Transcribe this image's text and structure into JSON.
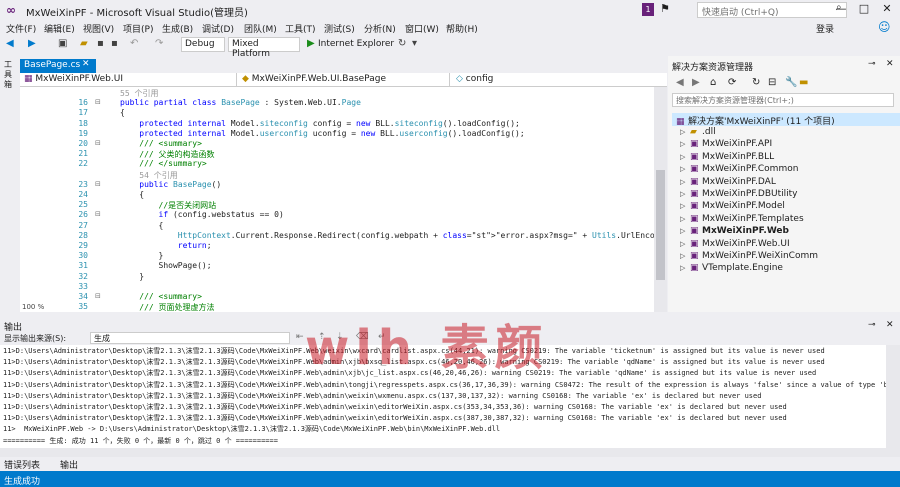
{
  "title": "MxWeiXinPF - Microsoft Visual Studio(管理员)",
  "badge": "1",
  "quick_launch": "快速启动 (Ctrl+Q)",
  "menu": [
    "文件(F)",
    "编辑(E)",
    "视图(V)",
    "项目(P)",
    "生成(B)",
    "调试(D)",
    "团队(M)",
    "工具(T)",
    "测试(S)",
    "分析(N)",
    "窗口(W)",
    "帮助(H)"
  ],
  "login": "登录",
  "toolbar": {
    "config": "Debug",
    "platform": "Mixed Platform",
    "run": "Internet Explorer"
  },
  "left_strip": "工具箱",
  "doc_tab": "BasePage.cs",
  "nav": {
    "project": "MxWeiXinPF.Web.UI",
    "class": "MxWeiXinPF.Web.UI.BasePage",
    "member": "config"
  },
  "code": [
    {
      "ln": "",
      "text": "55 个引用",
      "ref": true
    },
    {
      "ln": "16",
      "text": "public partial class BasePage : System.Web.UI.Page"
    },
    {
      "ln": "17",
      "text": "{"
    },
    {
      "ln": "18",
      "text": "    protected internal Model.siteconfig config = new BLL.siteconfig().loadConfig();"
    },
    {
      "ln": "19",
      "text": "    protected internal Model.userconfig uconfig = new BLL.userconfig().loadConfig();"
    },
    {
      "ln": "20",
      "text": "    /// <summary>"
    },
    {
      "ln": "21",
      "text": "    /// 父类的构造函数"
    },
    {
      "ln": "22",
      "text": "    /// </summary>"
    },
    {
      "ln": "",
      "text": "    54 个引用",
      "ref": true
    },
    {
      "ln": "23",
      "text": "    public BasePage()"
    },
    {
      "ln": "24",
      "text": "    {"
    },
    {
      "ln": "25",
      "text": "        //是否关闭网站"
    },
    {
      "ln": "26",
      "text": "        if (config.webstatus == 0)"
    },
    {
      "ln": "27",
      "text": "        {"
    },
    {
      "ln": "28",
      "text": "            HttpContext.Current.Response.Redirect(config.webpath + \"error.aspx?msg=\" + Utils.UrlEncode(config.webcloser"
    },
    {
      "ln": "29",
      "text": "            return;"
    },
    {
      "ln": "30",
      "text": "        }"
    },
    {
      "ln": "31",
      "text": "        ShowPage();"
    },
    {
      "ln": "32",
      "text": "    }"
    },
    {
      "ln": "33",
      "text": ""
    },
    {
      "ln": "34",
      "text": "    /// <summary>"
    },
    {
      "ln": "35",
      "text": "    /// 页面处理虚方法"
    }
  ],
  "zoom": "100 %",
  "solution_explorer": {
    "title": "解决方案资源管理器",
    "search": "搜索解决方案资源管理器(Ctrl+;)",
    "solution": "解决方案'MxWeiXinPF' (11 个项目)",
    "items": [
      ".dll",
      "MxWeiXinPF.API",
      "MxWeiXinPF.BLL",
      "MxWeiXinPF.Common",
      "MxWeiXinPF.DAL",
      "MxWeiXinPF.DBUtility",
      "MxWeiXinPF.Model",
      "MxWeiXinPF.Templates",
      "MxWeiXinPF.Web",
      "MxWeiXinPF.Web.UI",
      "MxWeiXinPF.WeiXinComm",
      "VTemplate.Engine"
    ]
  },
  "output": {
    "title": "输出",
    "source_label": "显示输出来源(S):",
    "source_value": "生成",
    "lines": [
      "11>D:\\Users\\Administrator\\Desktop\\沫雪2.1.3\\沫雪2.1.3源码\\Code\\MxWeiXinPF.Web\\weixin\\wxcard\\cardlist.aspx.cs(44,21): warning CS0219: The variable 'ticketnum' is assigned but its value is never used",
      "11>D:\\Users\\Administrator\\Desktop\\沫雪2.1.3\\沫雪2.1.3源码\\Code\\MxWeiXinPF.Web\\admin\\xjb\\bxsq_list.aspx.cs(46,20,46,26): warning CS0219: The variable 'qdName' is assigned but its value is never used",
      "11>D:\\Users\\Administrator\\Desktop\\沫雪2.1.3\\沫雪2.1.3源码\\Code\\MxWeiXinPF.Web\\admin\\xjb\\jc_list.aspx.cs(46,20,46,26): warning CS0219: The variable 'qdName' is assigned but its value is never used",
      "11>D:\\Users\\Administrator\\Desktop\\沫雪2.1.3\\沫雪2.1.3源码\\Code\\MxWeiXinPF.Web\\admin\\tongji\\regresspets.aspx.cs(36,17,36,39): warning CS0472: The result of the expression is always 'false' since a value of type 'bool'",
      "11>D:\\Users\\Administrator\\Desktop\\沫雪2.1.3\\沫雪2.1.3源码\\Code\\MxWeiXinPF.Web\\admin\\weixin\\wxmenu.aspx.cs(137,30,137,32): warning CS0168: The variable 'ex' is declared but never used",
      "11>D:\\Users\\Administrator\\Desktop\\沫雪2.1.3\\沫雪2.1.3源码\\Code\\MxWeiXinPF.Web\\admin\\weixin\\editorWeiXin.aspx.cs(353,34,353,36): warning CS0168: The variable 'ex' is declared but never used",
      "11>D:\\Users\\Administrator\\Desktop\\沫雪2.1.3\\沫雪2.1.3源码\\Code\\MxWeiXinPF.Web\\admin\\weixin\\editorWeiXin.aspx.cs(387,30,387,32): warning CS0168: The variable 'ex' is declared but never used",
      "11>  MxWeiXinPF.Web -> D:\\Users\\Administrator\\Desktop\\沫雪2.1.3\\沫雪2.1.3源码\\Code\\MxWeiXinPF.Web\\bin\\MxWeiXinPF.Web.dll",
      "========== 生成: 成功 11 个，失败 0 个，最新 0 个，跳过 0 个 =========="
    ]
  },
  "bottom_tabs": [
    "错误列表",
    "输出"
  ],
  "status": "生成成功",
  "watermark": "wlh 素颜",
  "colors": {
    "accent": "#007acc",
    "vs_purple": "#68217a",
    "keyword": "#0000ff",
    "type": "#2b91af",
    "string": "#a31515",
    "comment": "#008000"
  }
}
